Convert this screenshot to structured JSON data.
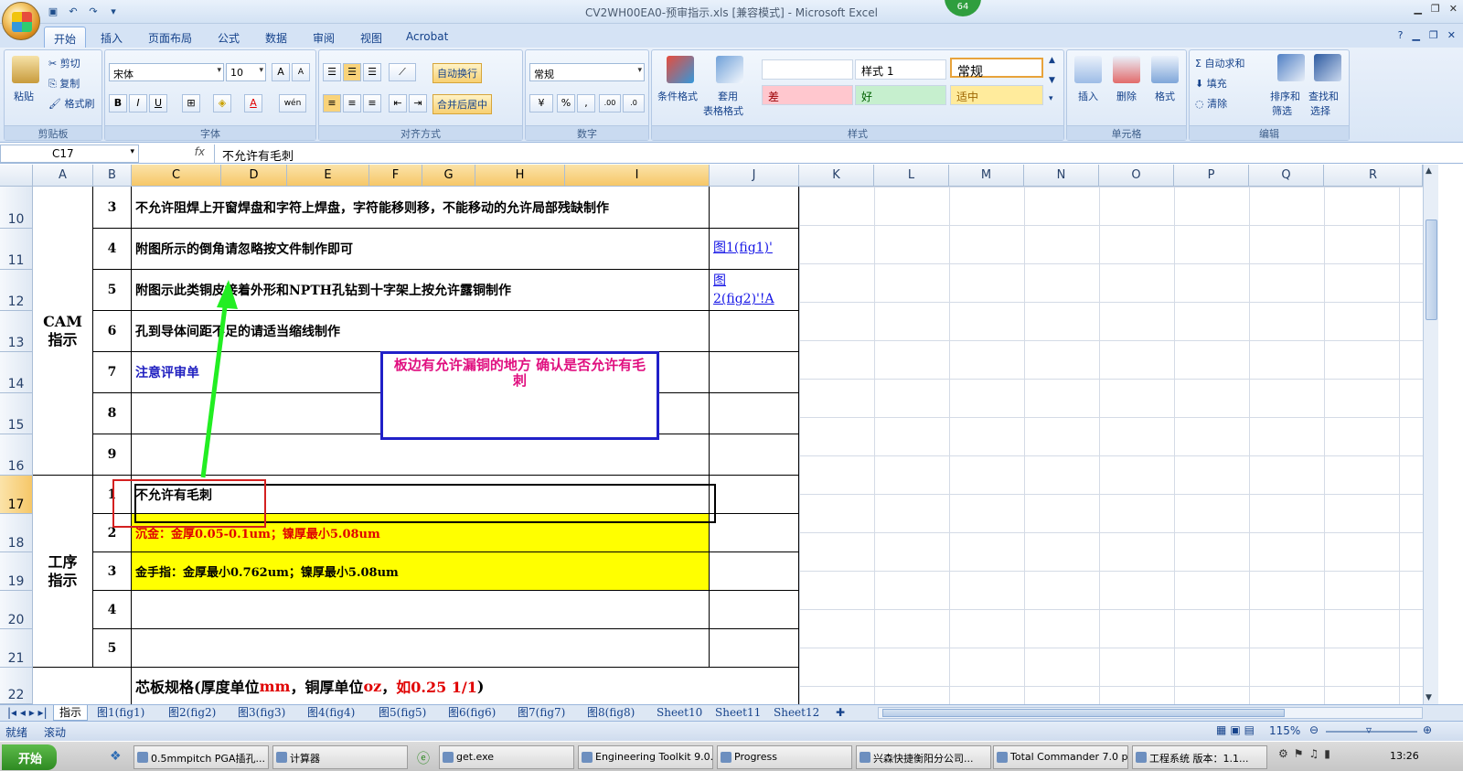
{
  "window": {
    "title": "CV2WH00EA0-预审指示.xls  [兼容模式] - Microsoft Excel",
    "badge": "64"
  },
  "tabs": [
    "开始",
    "插入",
    "页面布局",
    "公式",
    "数据",
    "审阅",
    "视图",
    "Acrobat"
  ],
  "ribbon": {
    "clipboard": {
      "paste": "粘贴",
      "cut": "剪切",
      "copy": "复制",
      "format_painter": "格式刷",
      "label": "剪贴板"
    },
    "font": {
      "name": "宋体",
      "size": "10",
      "label": "字体",
      "bold": "B",
      "italic": "I",
      "underline": "U",
      "grow": "A",
      "shrink": "A",
      "color_a": "A",
      "wen": "wén"
    },
    "align": {
      "wrap": "自动换行",
      "merge": "合并后居中",
      "label": "对齐方式"
    },
    "number": {
      "format": "常规",
      "percent": "%",
      "comma": ",",
      "label": "数字",
      "inc": ".00",
      "dec": ".0"
    },
    "styles": {
      "cond": "条件格式",
      "table": "套用",
      "table2": "表格格式",
      "s1": "样式 1",
      "normal": "常规",
      "bad": "差",
      "good": "好",
      "neutral": "适中",
      "label": "样式"
    },
    "cells": {
      "insert": "插入",
      "delete": "删除",
      "format": "格式",
      "label": "单元格"
    },
    "editing": {
      "autosum": "自动求和",
      "fill": "填充",
      "clear": "清除",
      "sort": "排序和",
      "sort2": "筛选",
      "find": "查找和",
      "find2": "选择",
      "label": "编辑"
    }
  },
  "formula": {
    "namebox": "C17",
    "fx": "fx",
    "content": "不允许有毛刺"
  },
  "columns": [
    "A",
    "B",
    "C",
    "D",
    "E",
    "F",
    "G",
    "H",
    "I",
    "J",
    "K",
    "L",
    "M",
    "N",
    "O",
    "P",
    "Q",
    "R"
  ],
  "rows": [
    "10",
    "11",
    "12",
    "13",
    "14",
    "15",
    "16",
    "17",
    "18",
    "19",
    "20",
    "21",
    "22"
  ],
  "sheet": {
    "cam_label": "CAM\n指示",
    "proc_label": "工序\n指示",
    "cam_items": [
      {
        "n": "3",
        "text": "不允许阻焊上开窗焊盘和字符上焊盘，字符能移则移，不能移动的允许局部残缺制作"
      },
      {
        "n": "4",
        "text": "附图所示的倒角请忽略按文件制作即可",
        "link": "图1(fig1)'"
      },
      {
        "n": "5",
        "text": "附图示此类铜皮接着外形和NPTH孔钻到十字架上按允许露铜制作",
        "link": "图\n2(fig2)'!A"
      },
      {
        "n": "6",
        "text": "孔到导体间距不足的请适当缩线制作"
      },
      {
        "n": "7",
        "text": "注意评审单"
      },
      {
        "n": "8",
        "text": ""
      },
      {
        "n": "9",
        "text": ""
      }
    ],
    "proc_items": [
      {
        "n": "1",
        "text": "不允许有毛刺"
      },
      {
        "n": "2",
        "text": "沉金：金厚0.05-0.1um；镍厚最小5.08um"
      },
      {
        "n": "3",
        "text": "金手指：金厚最小0.762um；镍厚最小5.08um"
      },
      {
        "n": "4",
        "text": ""
      },
      {
        "n": "5",
        "text": ""
      }
    ],
    "core_spec": {
      "a": "芯板规格(厚度单位",
      "b": "mm",
      "c": "，铜厚单位",
      "d": "oz",
      "e": "，",
      "f": "如0.25 1/1",
      ")": ")"
    }
  },
  "callout": "板边有允许漏铜的地方   确认是否允许有毛刺",
  "sheet_tabs": [
    "指示",
    "图1(fig1)",
    "图2(fig2)",
    "图3(fig3)",
    "图4(fig4)",
    "图5(fig5)",
    "图6(fig6)",
    "图7(fig7)",
    "图8(fig8)",
    "Sheet10",
    "Sheet11",
    "Sheet12"
  ],
  "status": {
    "ready": "就绪",
    "scroll": "滚动",
    "zoom": "115%"
  },
  "taskbar": {
    "start": "开始",
    "items": [
      "0.5mmpitch PGA插孔...",
      "计算器",
      "get.exe",
      "Engineering Toolkit 9.0...",
      "Progress",
      "兴森快捷衡阳分公司...",
      "Total Commander 7.0 p...",
      "工程系统  版本：1.1..."
    ],
    "clock": "13:26"
  },
  "colors": {
    "yellow": "#ffff00",
    "red_text": "#e00000",
    "link": "#1515e6",
    "arrow": "#22ee22",
    "callout_border": "#2020c8",
    "callout_text": "#e01080"
  }
}
